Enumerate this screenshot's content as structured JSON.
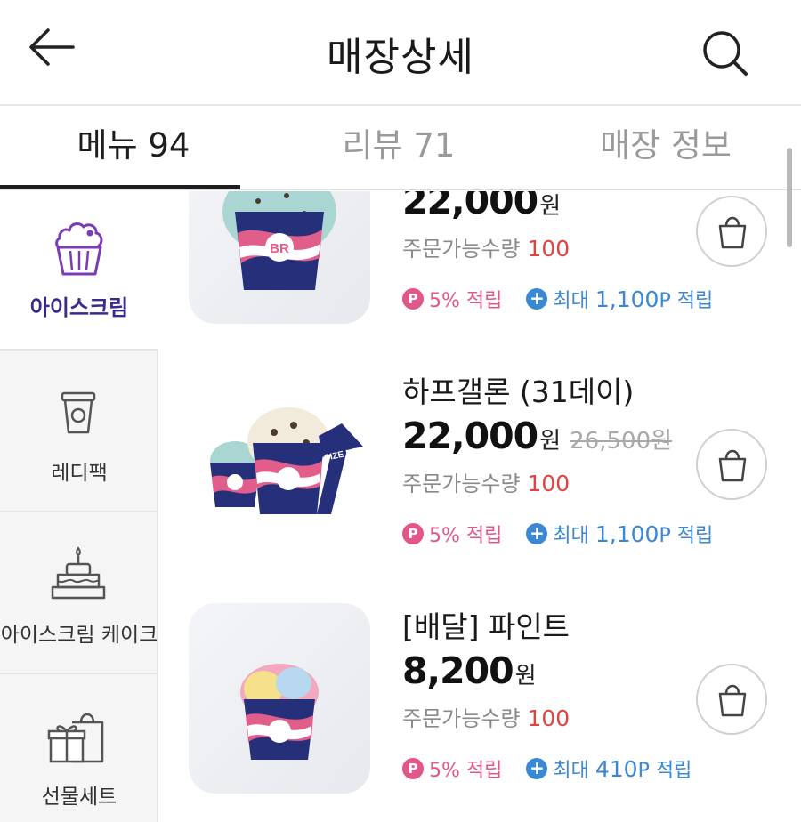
{
  "header": {
    "back_icon": "arrow-left-icon",
    "title": "매장상세",
    "search_icon": "search-icon"
  },
  "tabs": [
    {
      "label": "메뉴 94",
      "active": true
    },
    {
      "label": "리뷰 71",
      "active": false
    },
    {
      "label": "매장 정보",
      "active": false
    }
  ],
  "sidebar": {
    "items": [
      {
        "label": "아이스크림",
        "icon": "ice-cream-cup-icon",
        "active": true
      },
      {
        "label": "레디팩",
        "icon": "ready-pack-cup-icon",
        "active": false
      },
      {
        "label": "아이스크림 케이크",
        "icon": "cake-icon",
        "active": false
      },
      {
        "label": "선물세트",
        "icon": "gift-set-icon",
        "active": false
      }
    ]
  },
  "products": [
    {
      "name": "",
      "price": "22,000",
      "currency": "원",
      "old_price": "",
      "qty_label": "주문가능수량",
      "qty": "100",
      "point_badge": "P",
      "point_rate": "5%",
      "point_label": "적립",
      "max_prefix": "최대",
      "max_points": "1,100",
      "max_unit": "P",
      "max_label": "적립"
    },
    {
      "name": "하프갤론 (31데이)",
      "price": "22,000",
      "currency": "원",
      "old_price": "26,500원",
      "qty_label": "주문가능수량",
      "qty": "100",
      "point_badge": "P",
      "point_rate": "5%",
      "point_label": "적립",
      "max_prefix": "최대",
      "max_points": "1,100",
      "max_unit": "P",
      "max_label": "적립",
      "image_badge": "SIZE UP"
    },
    {
      "name": "[배달] 파인트",
      "price": "8,200",
      "currency": "원",
      "old_price": "",
      "qty_label": "주문가능수량",
      "qty": "100",
      "point_badge": "P",
      "point_rate": "5%",
      "point_label": "적립",
      "max_prefix": "최대",
      "max_points": "410",
      "max_unit": "P",
      "max_label": "적립"
    }
  ],
  "cup_logo": "BR",
  "colors": {
    "active_category": "#3a2a8c",
    "category_icon": "#7a3bb3",
    "qty_red": "#e0433f",
    "point_pink": "#e2578b",
    "point_blue": "#3a87d4",
    "cup_navy": "#262f7a",
    "cup_pink": "#e25e8a"
  }
}
